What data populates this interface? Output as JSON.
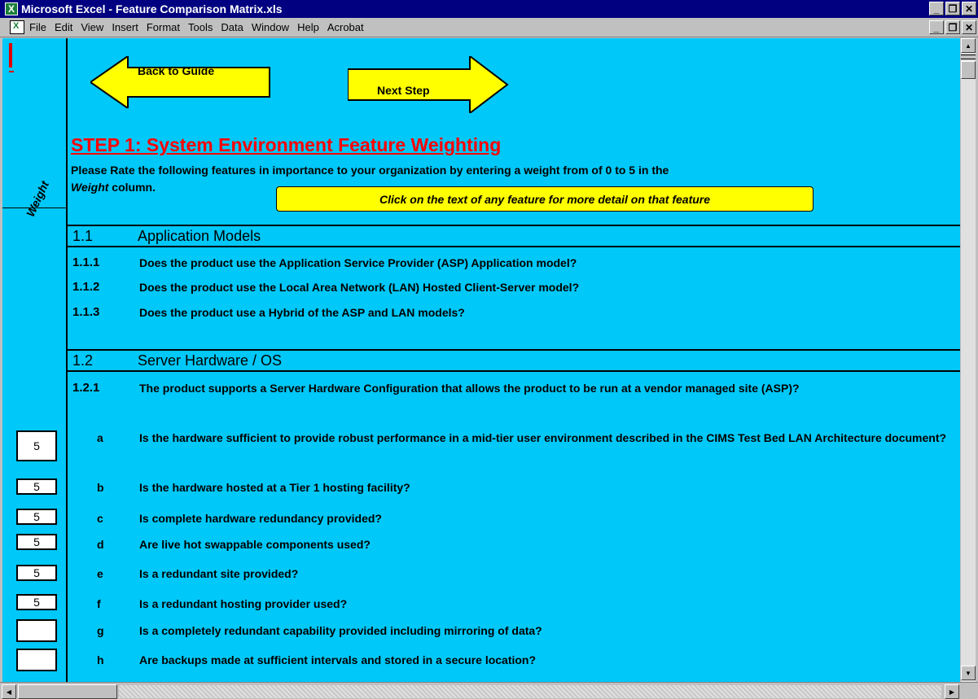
{
  "window": {
    "title": "Microsoft Excel - Feature Comparison Matrix.xls",
    "buttons": [
      "_",
      "🗗",
      "✕"
    ]
  },
  "menu": [
    "File",
    "Edit",
    "View",
    "Insert",
    "Format",
    "Tools",
    "Data",
    "Window",
    "Help",
    "Acrobat"
  ],
  "nav": {
    "back_label": "Back to Guide",
    "next_label": "Next Step",
    "arrow_color": "#ffff00"
  },
  "sheet": {
    "weight_label": "Weight",
    "step_title": "STEP 1: System Environment Feature Weighting",
    "instructions_line1": "Please Rate the following features in importance to your organization by entering a weight from of 0 to 5 in the",
    "instructions_italic": "Weight",
    "instructions_line2": " column.",
    "click_note": "Click on the text of any feature for more detail on that feature",
    "background_color": "#00c8f8"
  },
  "sections": [
    {
      "num": "1.1",
      "title": "Application Models",
      "items": [
        {
          "num": "1.1.1",
          "text": "Does the product use the Application Service Provider (ASP) Application model?"
        },
        {
          "num": "1.1.2",
          "text": "Does the product use the Local Area Network (LAN) Hosted Client-Server model?"
        },
        {
          "num": "1.1.3",
          "text": "Does the product use a Hybrid of the ASP and LAN models?"
        }
      ]
    },
    {
      "num": "1.2",
      "title": "Server Hardware / OS",
      "items": [
        {
          "num": "1.2.1",
          "text": "The product supports a Server Hardware Configuration that allows the product to be run at a vendor managed site (ASP)?"
        }
      ],
      "subitems": [
        {
          "letter": "a",
          "text": "Is the hardware sufficient to provide robust performance in a mid-tier user environment described in the CIMS Test Bed LAN Architecture document?",
          "weight": "5"
        },
        {
          "letter": "b",
          "text": "Is the hardware hosted at a Tier 1 hosting facility?",
          "weight": "5"
        },
        {
          "letter": "c",
          "text": "Is complete hardware redundancy provided?",
          "weight": "5"
        },
        {
          "letter": "d",
          "text": "Are live hot swappable components used?",
          "weight": "5"
        },
        {
          "letter": "e",
          "text": "Is a redundant site provided?",
          "weight": "5"
        },
        {
          "letter": "f",
          "text": "Is a redundant hosting provider used?",
          "weight": "5"
        },
        {
          "letter": "g",
          "text": "Is a completely redundant capability provided including mirroring of data?",
          "weight": ""
        },
        {
          "letter": "h",
          "text": "Are backups made at sufficient intervals and stored in a secure location?",
          "weight": ""
        }
      ]
    }
  ]
}
